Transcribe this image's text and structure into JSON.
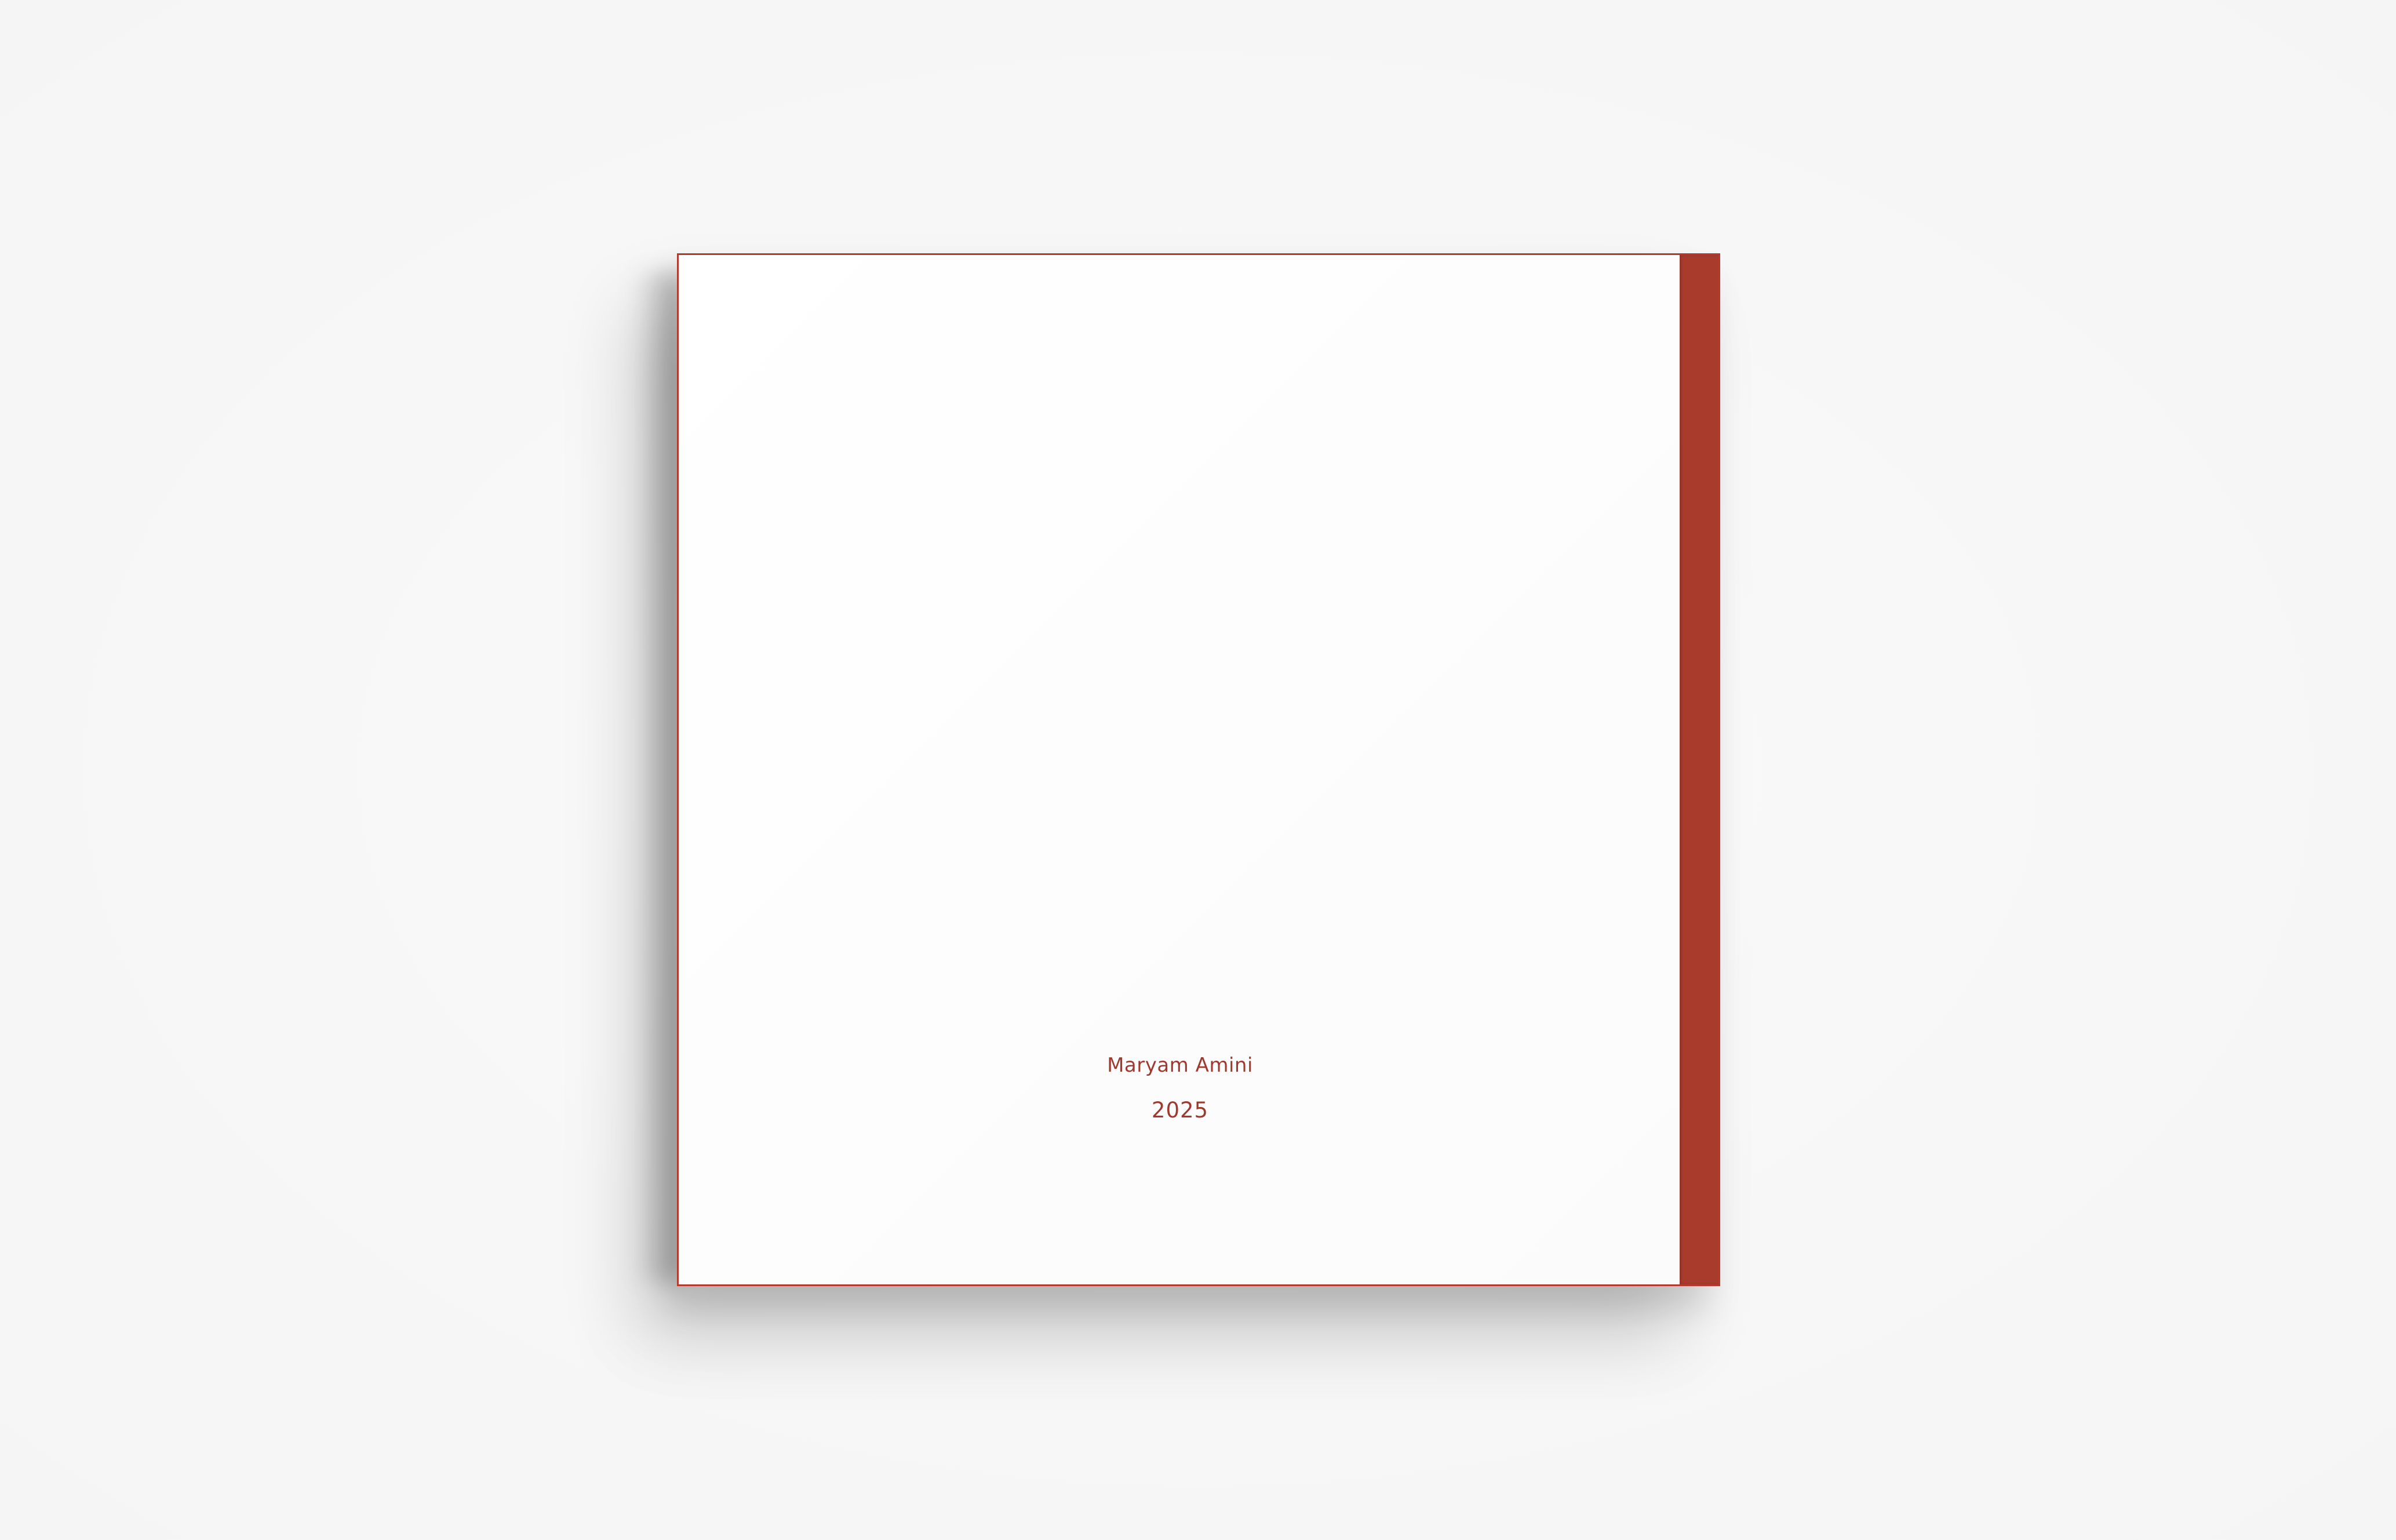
{
  "book": {
    "author": "Maryam Amini",
    "year": "2025"
  },
  "colors": {
    "background": "#f7f7f7",
    "cover": "#ffffff",
    "spine": "#a83b2c",
    "text": "#a0392d"
  }
}
